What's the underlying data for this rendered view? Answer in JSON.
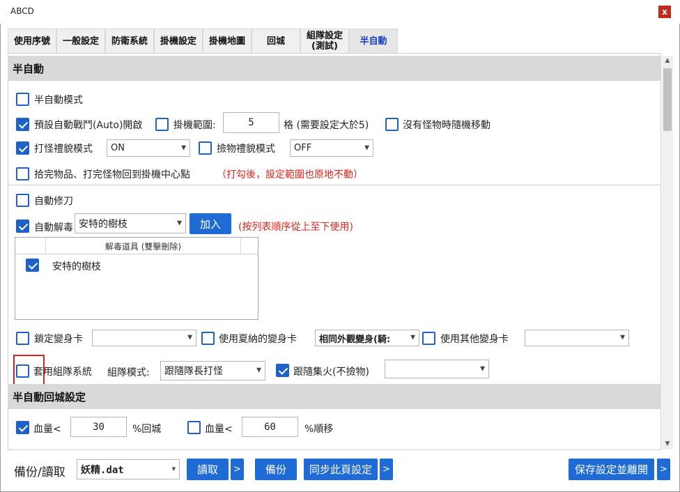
{
  "window": {
    "title": "ABCD",
    "close_label": "x"
  },
  "tabs": [
    {
      "label": "使用序號"
    },
    {
      "label": "一般設定"
    },
    {
      "label": "防衛系統"
    },
    {
      "label": "掛機設定"
    },
    {
      "label": "掛機地圖"
    },
    {
      "label": "回城"
    },
    {
      "label": "組隊設定\n(測試)"
    },
    {
      "label": "半自動",
      "active": true
    }
  ],
  "section_semi_auto": {
    "title": "半自動",
    "semi_auto_mode": {
      "label": "半自動模式",
      "checked": false
    },
    "auto_battle": {
      "label": "預設自動戰鬥(Auto)開啟",
      "checked": true
    },
    "hang_range": {
      "label": "掛機範圍:",
      "checked": false,
      "value": "5",
      "suffix": "格 (需要設定大於5)"
    },
    "random_move": {
      "label": "沒有怪物時隨機移動",
      "checked": false
    },
    "attack_mode": {
      "label": "打怪禮貌模式",
      "checked": true,
      "value": "ON"
    },
    "pickup_mode": {
      "label": "撿物禮貌模式",
      "checked": false,
      "value": "OFF"
    },
    "return_center": {
      "label": "拾完物品、打完怪物回到掛機中心點",
      "checked": false,
      "note": "（打勾後，設定範圍也原地不動）"
    },
    "auto_repair": {
      "label": "自動修刀",
      "checked": false
    },
    "auto_detox": {
      "label": "自動解毒",
      "checked": true,
      "value": "安特的樹枝",
      "add_label": "加入",
      "note": "(按列表順序從上至下使用)"
    },
    "detox_list": {
      "header": "解毒道具 (雙擊刪除)",
      "items": [
        {
          "label": "安特的樹枝",
          "checked": true
        }
      ]
    },
    "lock_card": {
      "label": "鎖定變身卡",
      "checked": false,
      "value": ""
    },
    "summer_card": {
      "label": "使用夏納的變身卡",
      "checked": false,
      "value": "相同外觀變身(騎:"
    },
    "other_card": {
      "label": "使用其他變身卡",
      "checked": false,
      "value": ""
    },
    "party_system": {
      "label": "套用組隊系統",
      "checked": false
    },
    "party_mode": {
      "label": "組隊模式:",
      "value": "跟隨隊長打怪"
    },
    "follow_fire": {
      "label": "跟隨集火(不撿物)",
      "checked": true,
      "value": ""
    }
  },
  "section_return": {
    "title": "半自動回城設定",
    "hp_return": {
      "label": "血量<",
      "checked": true,
      "value": "30",
      "suffix": "%回城"
    },
    "hp_teleport": {
      "label": "血量<",
      "checked": false,
      "value": "60",
      "suffix": "%順移"
    }
  },
  "footer": {
    "backup_label": "備份/讀取",
    "file_value": "妖精.dat",
    "read_label": "讀取",
    "more_label": ">",
    "backup_btn": "備份",
    "sync_label": "同步此頁設定",
    "save_label": "保存設定並離開"
  },
  "colors": {
    "accent": "#1e6bd6",
    "note": "#e0261c",
    "section_bg": "#d9d9d9",
    "close": "#c42b1c"
  }
}
